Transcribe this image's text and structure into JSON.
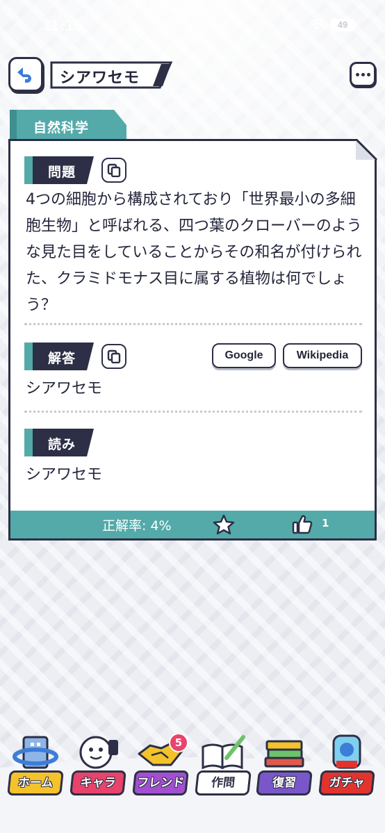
{
  "status_bar": {
    "time": "11:16",
    "battery": "49"
  },
  "header": {
    "title": "シアワセモ"
  },
  "category": {
    "label": "自然科学"
  },
  "question": {
    "label": "問題",
    "text": "4つの細胞から構成されており「世界最小の多細胞生物」と呼ばれる、四つ葉のクローバーのような見た目をしていることからその和名が付けられた、クラミドモナス目に属する植物は何でしょう？"
  },
  "answer": {
    "label": "解答",
    "text": "シアワセモ",
    "links": {
      "google": "Google",
      "wikipedia": "Wikipedia"
    }
  },
  "reading": {
    "label": "読み",
    "text": "シアワセモ"
  },
  "footer": {
    "accuracy": "正解率: 4%",
    "likes": "1"
  },
  "nav": {
    "items": [
      {
        "label": "ホーム",
        "icon": "home-icon",
        "color": "#f4c22b"
      },
      {
        "label": "キャラ",
        "icon": "character-icon",
        "color": "#e8436b"
      },
      {
        "label": "フレンド",
        "icon": "handshake-icon",
        "color": "#a24fd0",
        "badge": "5"
      },
      {
        "label": "作問",
        "icon": "book-pencil-icon",
        "color": "#ffffff"
      },
      {
        "label": "復習",
        "icon": "stack-books-icon",
        "color": "#7a57c9"
      },
      {
        "label": "ガチャ",
        "icon": "gacha-icon",
        "color": "#e2342f"
      }
    ]
  },
  "colors": {
    "teal": "#54aaa9",
    "navy": "#2c2f45"
  }
}
